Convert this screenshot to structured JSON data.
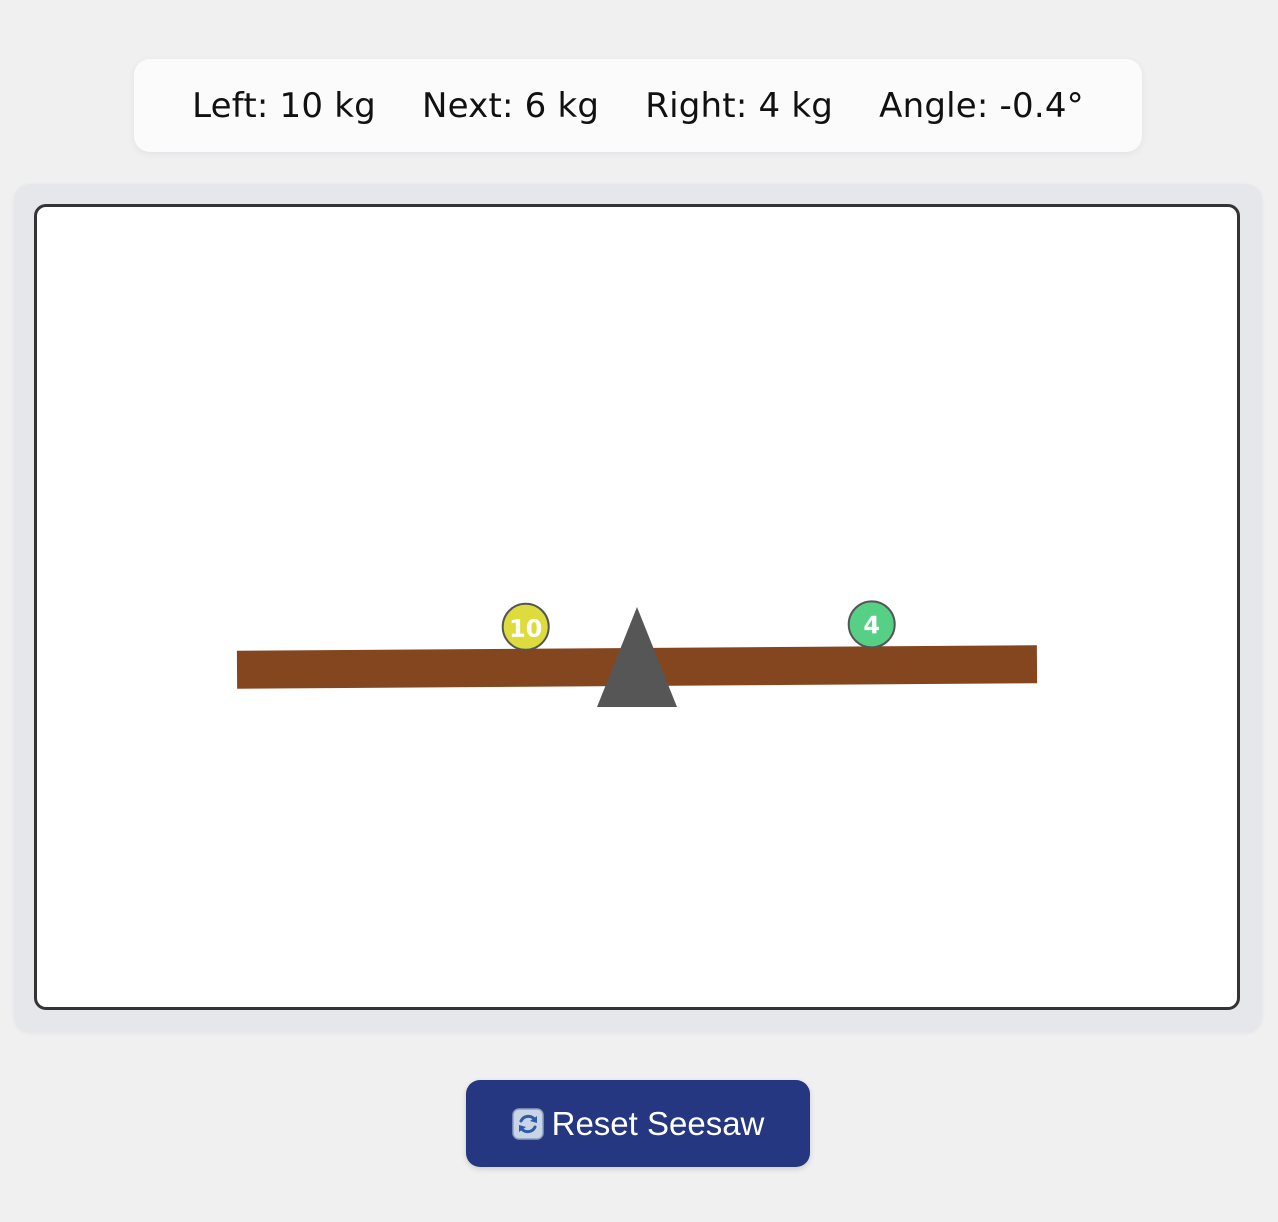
{
  "stats": {
    "left": "Left: 10 kg",
    "next": "Next: 6 kg",
    "right": "Right: 4 kg",
    "angle": "Angle: -0.4°"
  },
  "seesaw": {
    "angle_deg": -0.4,
    "plank_color": "#84461f",
    "fulcrum_color": "#565656",
    "weights": [
      {
        "label": "10",
        "kg": 10,
        "side": "left",
        "color": "#dddc3c"
      },
      {
        "label": "4",
        "kg": 4,
        "side": "right",
        "color": "#55d084"
      }
    ]
  },
  "reset": {
    "icon": "refresh-icon",
    "label": "Reset Seesaw",
    "color": "#253781"
  }
}
